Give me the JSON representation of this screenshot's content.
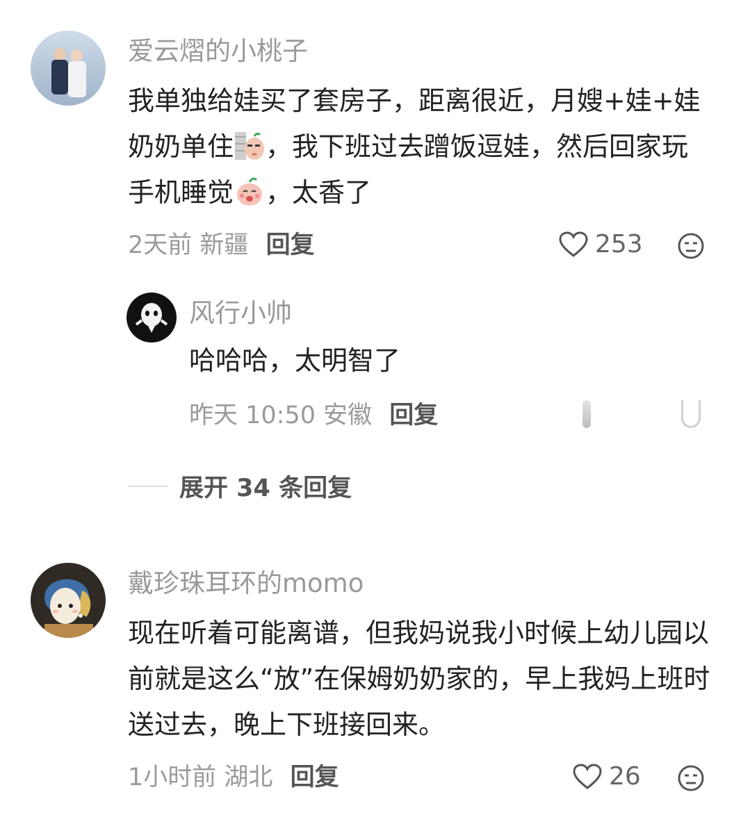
{
  "comments": [
    {
      "username": "爱云熠的小桃子",
      "content_parts": [
        "我单独给娃买了套房子，距离很近，月嫂+娃+娃奶奶单住",
        "，我下班过去蹭饭逗娃，然后回家玩手机睡觉",
        "，太香了"
      ],
      "emojis": [
        "wall-peek-emoji",
        "hehe-peach-emoji"
      ],
      "time": "2天前",
      "location": "新疆",
      "reply_label": "回复",
      "likes": "253",
      "reply": {
        "username": "风行小帅",
        "content": "哈哈哈，太明智了",
        "time": "昨天 10:50",
        "location": "安徽",
        "reply_label": "回复"
      },
      "expand_label": "展开 34 条回复"
    },
    {
      "username": "戴珍珠耳环的momo",
      "content": "现在听着可能离谱，但我妈说我小时候上幼儿园以前就是这么“放”在保姆奶奶家的，早上我妈上班时送过去，晚上下班接回来。",
      "time": "1小时前",
      "location": "湖北",
      "reply_label": "回复",
      "likes": "26"
    }
  ]
}
